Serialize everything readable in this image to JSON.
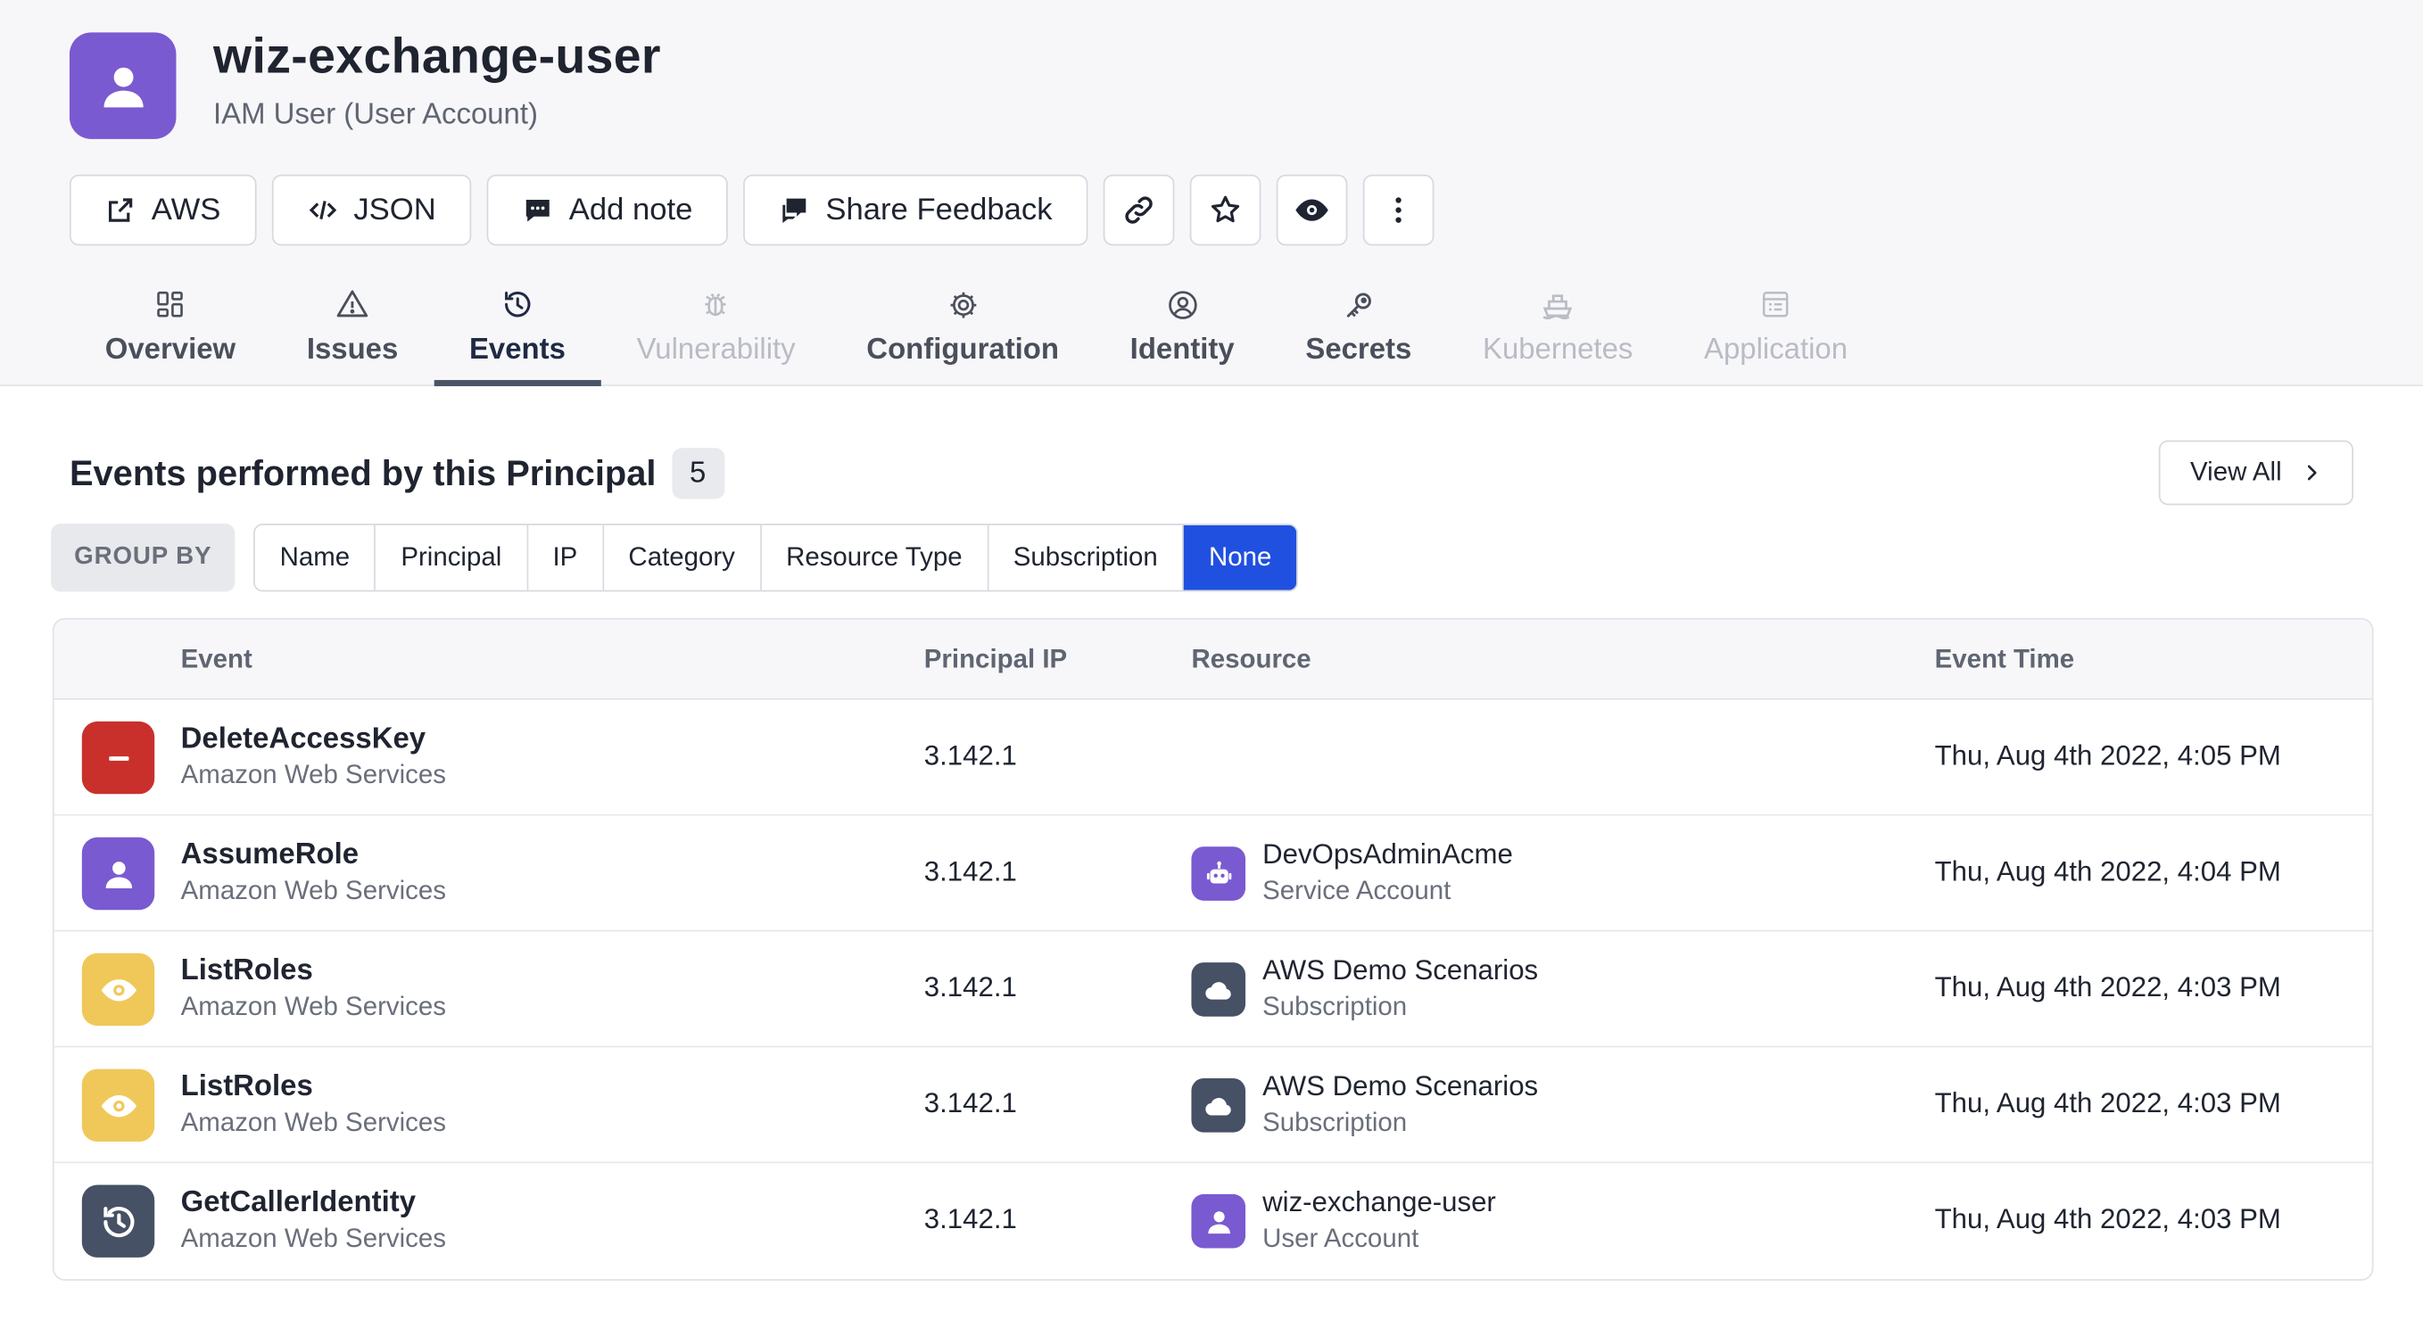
{
  "header": {
    "title": "wiz-exchange-user",
    "subtitle": "IAM User (User Account)",
    "avatar_icon": "user-icon",
    "avatar_color": "#7a5ad0"
  },
  "actions": [
    {
      "label": "AWS",
      "icon": "external-link-icon"
    },
    {
      "label": "JSON",
      "icon": "code-icon"
    },
    {
      "label": "Add note",
      "icon": "comment-icon"
    },
    {
      "label": "Share Feedback",
      "icon": "feedback-icon"
    }
  ],
  "icon_actions": [
    "link-icon",
    "star-icon",
    "eye-icon",
    "more-vertical-icon"
  ],
  "tabs": [
    {
      "label": "Overview",
      "icon": "grid-icon",
      "state": "normal"
    },
    {
      "label": "Issues",
      "icon": "warning-icon",
      "state": "normal"
    },
    {
      "label": "Events",
      "icon": "history-icon",
      "state": "active"
    },
    {
      "label": "Vulnerability",
      "icon": "bug-icon",
      "state": "disabled"
    },
    {
      "label": "Configuration",
      "icon": "gear-icon",
      "state": "normal"
    },
    {
      "label": "Identity",
      "icon": "user-circle-icon",
      "state": "normal"
    },
    {
      "label": "Secrets",
      "icon": "key-icon",
      "state": "normal"
    },
    {
      "label": "Kubernetes",
      "icon": "ship-icon",
      "state": "disabled"
    },
    {
      "label": "Application",
      "icon": "list-icon",
      "state": "disabled"
    }
  ],
  "section": {
    "title": "Events performed by this Principal",
    "count": "5",
    "view_all": "View All"
  },
  "groupby": {
    "label": "GROUP BY",
    "options": [
      "Name",
      "Principal",
      "IP",
      "Category",
      "Resource Type",
      "Subscription",
      "None"
    ],
    "selected": "None"
  },
  "table": {
    "columns": [
      "Event",
      "Principal IP",
      "Resource",
      "Event Time"
    ],
    "rows": [
      {
        "event": "DeleteAccessKey",
        "provider": "Amazon Web Services",
        "icon": "minus-icon",
        "color": "#c9302c",
        "ip": "3.142.1",
        "resource": "",
        "resource_type": "",
        "resource_icon": "",
        "resource_color": "",
        "time": "Thu, Aug 4th 2022, 4:05 PM"
      },
      {
        "event": "AssumeRole",
        "provider": "Amazon Web Services",
        "icon": "user-icon",
        "color": "#7a5ad0",
        "ip": "3.142.1",
        "resource": "DevOpsAdminAcme",
        "resource_type": "Service Account",
        "resource_icon": "robot-icon",
        "resource_color": "#7a5ad0",
        "time": "Thu, Aug 4th 2022, 4:04 PM"
      },
      {
        "event": "ListRoles",
        "provider": "Amazon Web Services",
        "icon": "eye-icon",
        "color": "#f0c85a",
        "ip": "3.142.1",
        "resource": "AWS Demo Scenarios",
        "resource_type": "Subscription",
        "resource_icon": "cloud-icon",
        "resource_color": "#465166",
        "time": "Thu, Aug 4th 2022, 4:03 PM"
      },
      {
        "event": "ListRoles",
        "provider": "Amazon Web Services",
        "icon": "eye-icon",
        "color": "#f0c85a",
        "ip": "3.142.1",
        "resource": "AWS Demo Scenarios",
        "resource_type": "Subscription",
        "resource_icon": "cloud-icon",
        "resource_color": "#465166",
        "time": "Thu, Aug 4th 2022, 4:03 PM"
      },
      {
        "event": "GetCallerIdentity",
        "provider": "Amazon Web Services",
        "icon": "history-icon",
        "color": "#465166",
        "ip": "3.142.1",
        "resource": "wiz-exchange-user",
        "resource_type": "User Account",
        "resource_icon": "user-icon",
        "resource_color": "#7a5ad0",
        "time": "Thu, Aug 4th 2022, 4:03 PM"
      }
    ]
  }
}
